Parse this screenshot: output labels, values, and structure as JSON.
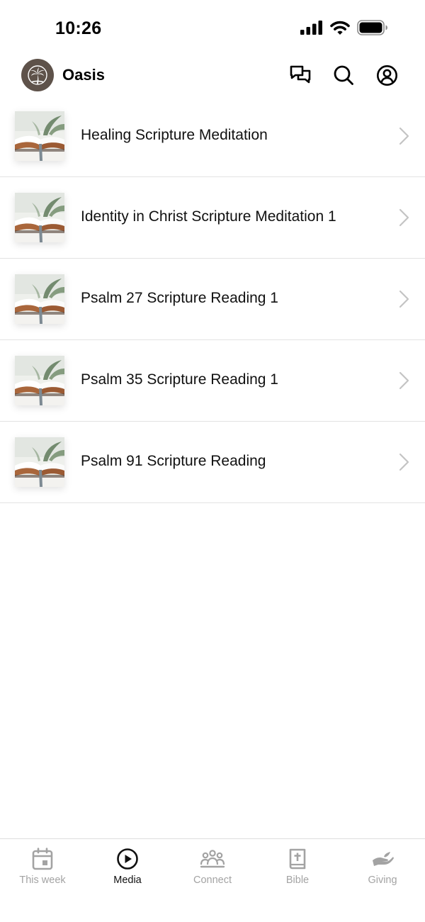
{
  "status_bar": {
    "time": "10:26"
  },
  "header": {
    "app_name": "Oasis"
  },
  "media_items": [
    {
      "title": "Healing Scripture Meditation"
    },
    {
      "title": "Identity in Christ Scripture Meditation 1"
    },
    {
      "title": "Psalm 27 Scripture Reading 1"
    },
    {
      "title": "Psalm 35 Scripture Reading 1"
    },
    {
      "title": "Psalm 91 Scripture Reading"
    }
  ],
  "tabs": [
    {
      "label": "This week",
      "icon": "calendar-icon",
      "active": false
    },
    {
      "label": "Media",
      "icon": "play-circle-icon",
      "active": true
    },
    {
      "label": "Connect",
      "icon": "group-icon",
      "active": false
    },
    {
      "label": "Bible",
      "icon": "bible-icon",
      "active": false
    },
    {
      "label": "Giving",
      "icon": "giving-hand-icon",
      "active": false
    }
  ],
  "colors": {
    "logo_background": "#5e524a",
    "active_tab": "#111111",
    "inactive_tab": "#a3a3a3",
    "divider": "#e2e2e2"
  }
}
